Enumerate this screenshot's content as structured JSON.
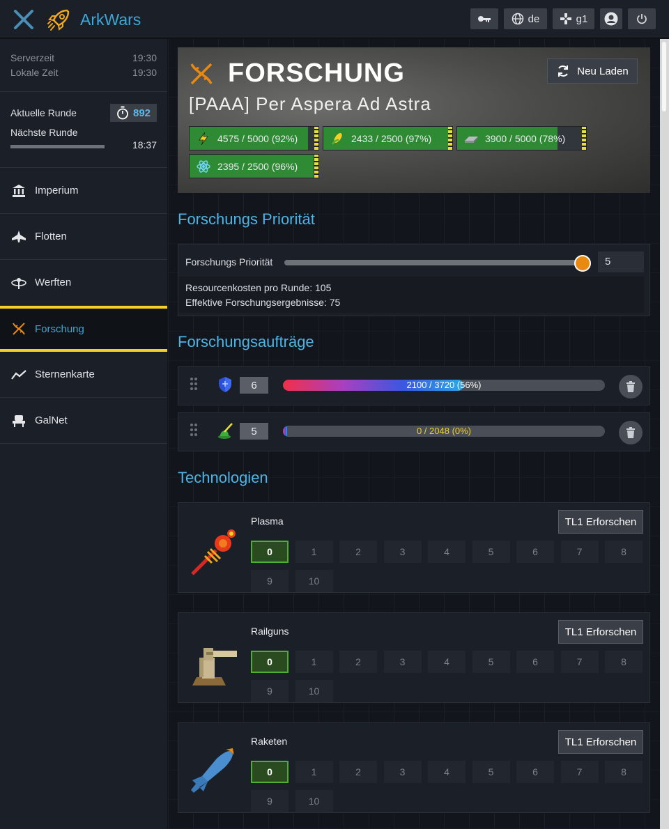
{
  "app": {
    "name": "ArkWars"
  },
  "topbar": {
    "lang_label": "de",
    "galaxy_label": "g1"
  },
  "sidebar": {
    "server_time_label": "Serverzeit",
    "server_time": "19:30",
    "local_time_label": "Lokale Zeit",
    "local_time": "19:30",
    "current_round_label": "Aktuelle Runde",
    "current_round": "892",
    "next_round_label": "Nächste Runde",
    "next_round_time": "18:37",
    "items": [
      {
        "label": "Imperium",
        "icon": "bank-icon"
      },
      {
        "label": "Flotten",
        "icon": "ship-icon"
      },
      {
        "label": "Werften",
        "icon": "shipyard-icon"
      },
      {
        "label": "Forschung",
        "icon": "dna-icon",
        "active": true
      },
      {
        "label": "Sternenkarte",
        "icon": "chart-line-icon"
      },
      {
        "label": "GalNet",
        "icon": "seat-icon"
      }
    ]
  },
  "hero": {
    "title": "FORSCHUNG",
    "subtitle": "[PAAA] Per Aspera Ad Astra",
    "reload_label": "Neu Laden",
    "resources": [
      {
        "icon": "energy-icon",
        "text": "4575 / 5000 (92%)",
        "fraction": 0.92
      },
      {
        "icon": "corn-icon",
        "text": "2433 / 2500 (97%)",
        "fraction": 0.97
      },
      {
        "icon": "metal-bar-icon",
        "text": "3900 / 5000 (78%)",
        "fraction": 0.78
      },
      {
        "icon": "atom-icon",
        "text": "2395 / 2500 (96%)",
        "fraction": 0.96
      }
    ]
  },
  "priority": {
    "section_title": "Forschungs Priorität",
    "label": "Forschungs Priorität",
    "value": "5",
    "slider_fraction": 1.0,
    "cost_text": "Resourcenkosten pro Runde: 105",
    "effective_text": "Effektive Forschungsergebnisse: 75"
  },
  "orders": {
    "section_title": "Forschungsaufträge",
    "items": [
      {
        "icon": "shield-icon",
        "count": "6",
        "progress_text": "2100 / 3720 (56%)",
        "fraction": 0.56
      },
      {
        "icon": "turret-icon",
        "count": "5",
        "progress_text": "0 / 2048 (0%)",
        "fraction": 0.0
      }
    ]
  },
  "technologies": {
    "section_title": "Technologien",
    "items": [
      {
        "name": "Plasma",
        "button": "TL1 Erforschen",
        "icon": "plasma-icon",
        "current_level": "0",
        "levels": [
          "0",
          "1",
          "2",
          "3",
          "4",
          "5",
          "6",
          "7",
          "8",
          "9",
          "10"
        ]
      },
      {
        "name": "Railguns",
        "button": "TL1 Erforschen",
        "icon": "railgun-icon",
        "current_level": "0",
        "levels": [
          "0",
          "1",
          "2",
          "3",
          "4",
          "5",
          "6",
          "7",
          "8",
          "9",
          "10"
        ]
      },
      {
        "name": "Raketen",
        "button": "TL1 Erforschen",
        "icon": "rocket-icon",
        "current_level": "0",
        "levels": [
          "0",
          "1",
          "2",
          "3",
          "4",
          "5",
          "6",
          "7",
          "8",
          "9",
          "10"
        ]
      }
    ]
  }
}
